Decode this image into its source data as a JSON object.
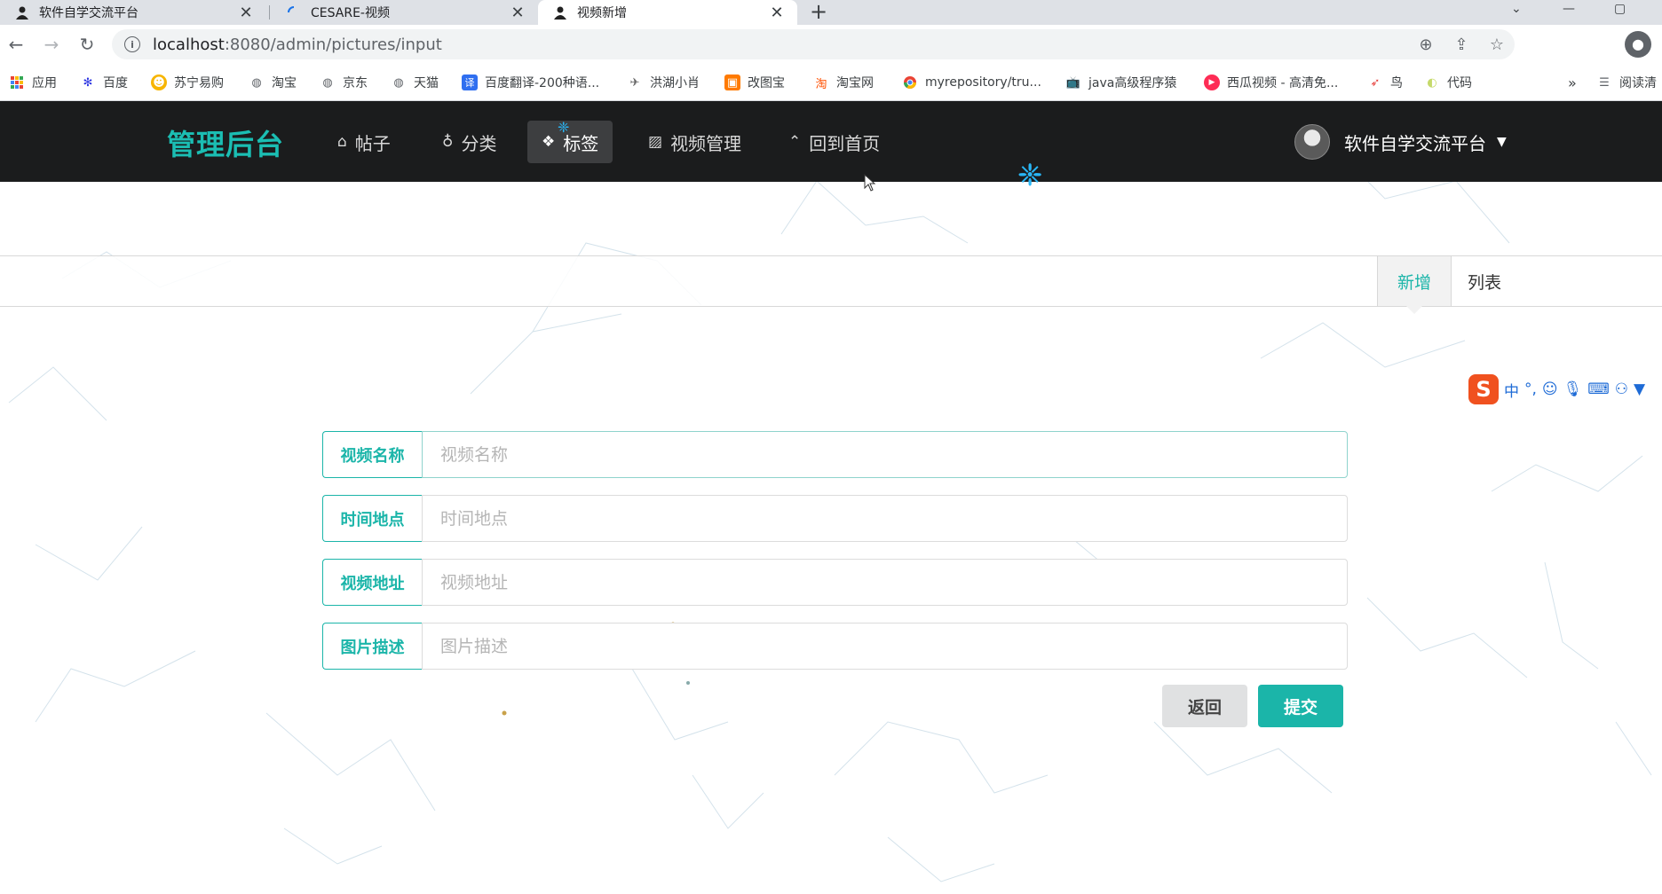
{
  "browser": {
    "tabs": [
      {
        "title": "软件自学交流平台",
        "active": false
      },
      {
        "title": "CESARE-视频",
        "active": false
      },
      {
        "title": "视频新增",
        "active": true
      }
    ],
    "url_host": "localhost",
    "url_path": ":8080/admin/pictures/input",
    "bookmarks": [
      {
        "label": "应用",
        "icon": "apps-grid-icon"
      },
      {
        "label": "百度",
        "icon": "baidu-paw-icon"
      },
      {
        "label": "苏宁易购",
        "icon": "suning-icon"
      },
      {
        "label": "淘宝",
        "icon": "globe-icon"
      },
      {
        "label": "京东",
        "icon": "globe-icon"
      },
      {
        "label": "天猫",
        "icon": "globe-icon"
      },
      {
        "label": "百度翻译-200种语...",
        "icon": "translate-icon"
      },
      {
        "label": "洪湖小肖",
        "icon": "bird-icon"
      },
      {
        "label": "改图宝",
        "icon": "gaitubao-icon"
      },
      {
        "label": "淘宝网",
        "icon": "taobao-icon"
      },
      {
        "label": "myrepository/tru...",
        "icon": "chrome-icon"
      },
      {
        "label": "java高级程序猿",
        "icon": "bilibili-icon"
      },
      {
        "label": "西瓜视频 - 高清免...",
        "icon": "xigua-icon"
      },
      {
        "label": "鸟",
        "icon": "bird-red-icon"
      },
      {
        "label": "代码",
        "icon": "code-icon"
      }
    ],
    "more_bookmarks": "»",
    "reading_list": "阅读清"
  },
  "app": {
    "brand": "管理后台",
    "menu": [
      {
        "label": "帖子",
        "icon": "home-icon",
        "active": false
      },
      {
        "label": "分类",
        "icon": "lightbulb-icon",
        "active": false
      },
      {
        "label": "标签",
        "icon": "tags-icon",
        "active": true
      },
      {
        "label": "视频管理",
        "icon": "image-icon",
        "active": false
      },
      {
        "label": "回到首页",
        "icon": "double-chevron-up-icon",
        "active": false
      }
    ],
    "user_name": "软件自学交流平台"
  },
  "subnav": {
    "tabs": [
      {
        "label": "新增",
        "active": true
      },
      {
        "label": "列表",
        "active": false
      }
    ]
  },
  "ime": {
    "mode": "中",
    "punct": "°,"
  },
  "form": {
    "fields": [
      {
        "label": "视频名称",
        "placeholder": "视频名称",
        "value": ""
      },
      {
        "label": "时间地点",
        "placeholder": "时间地点",
        "value": ""
      },
      {
        "label": "视频地址",
        "placeholder": "视频地址",
        "value": ""
      },
      {
        "label": "图片描述",
        "placeholder": "图片描述",
        "value": ""
      }
    ],
    "back_label": "返回",
    "submit_label": "提交"
  },
  "colors": {
    "accent": "#1bb5a9",
    "navbar_bg": "#1b1c1d",
    "back_button_bg": "#e0e1e2"
  }
}
